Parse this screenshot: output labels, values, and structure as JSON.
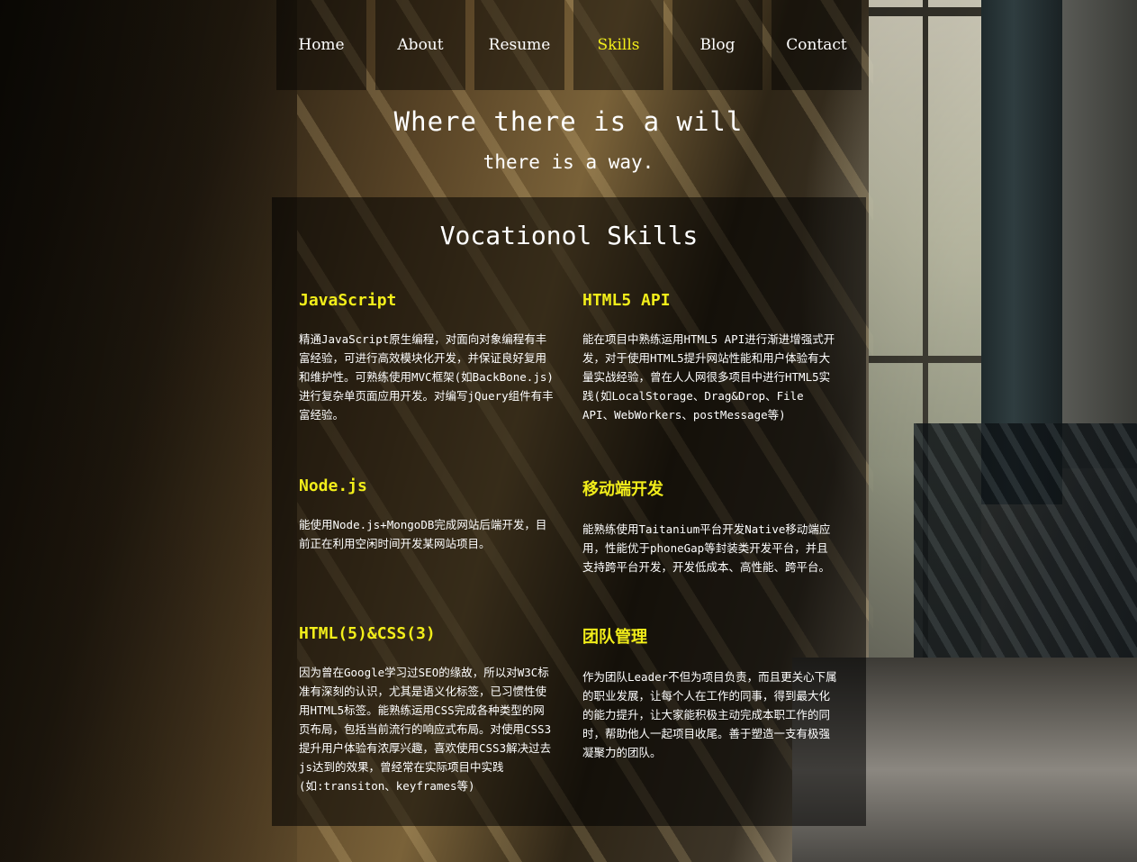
{
  "nav": {
    "items": [
      "Home",
      "About",
      "Resume",
      "Skills",
      "Blog",
      "Contact"
    ],
    "active": "Skills"
  },
  "motto": {
    "line1": "Where there is a will",
    "line2": "there is a way."
  },
  "skills_section": {
    "title": "Vocationol Skills",
    "skills": [
      {
        "title": "JavaScript",
        "text": "精通JavaScript原生编程，对面向对象编程有丰富经验，可进行高效模块化开发，并保证良好复用和维护性。可熟练使用MVC框架(如BackBone.js)进行复杂单页面应用开发。对编写jQuery组件有丰富经验。"
      },
      {
        "title": "HTML5 API",
        "text": "能在项目中熟练运用HTML5 API进行渐进增强式开发，对于使用HTML5提升网站性能和用户体验有大量实战经验，曾在人人网很多项目中进行HTML5实践(如LocalStorage、Drag&Drop、File API、WebWorkers、postMessage等)"
      },
      {
        "title": "Node.js",
        "text": "能使用Node.js+MongoDB完成网站后端开发，目前正在利用空闲时间开发某网站项目。"
      },
      {
        "title": "移动端开发",
        "text": "能熟练使用Taitanium平台开发Native移动端应用，性能优于phoneGap等封装类开发平台，并且支持跨平台开发，开发低成本、高性能、跨平台。"
      },
      {
        "title": "HTML(5)&CSS(3)",
        "text": "因为曾在Google学习过SEO的缘故，所以对W3C标准有深刻的认识，尤其是语义化标签，已习惯性使用HTML5标签。能熟练运用CSS完成各种类型的网页布局，包括当前流行的响应式布局。对使用CSS3提升用户体验有浓厚兴趣，喜欢使用CSS3解决过去js达到的效果，曾经常在实际项目中实践(如:transiton、keyframes等)"
      },
      {
        "title": "团队管理",
        "text": "作为团队Leader不但为项目负责，而且更关心下属的职业发展，让每个人在工作的同事，得到最大化的能力提升，让大家能积极主动完成本职工作的同时，帮助他人一起项目收尾。善于塑造一支有极强凝聚力的团队。"
      }
    ]
  }
}
